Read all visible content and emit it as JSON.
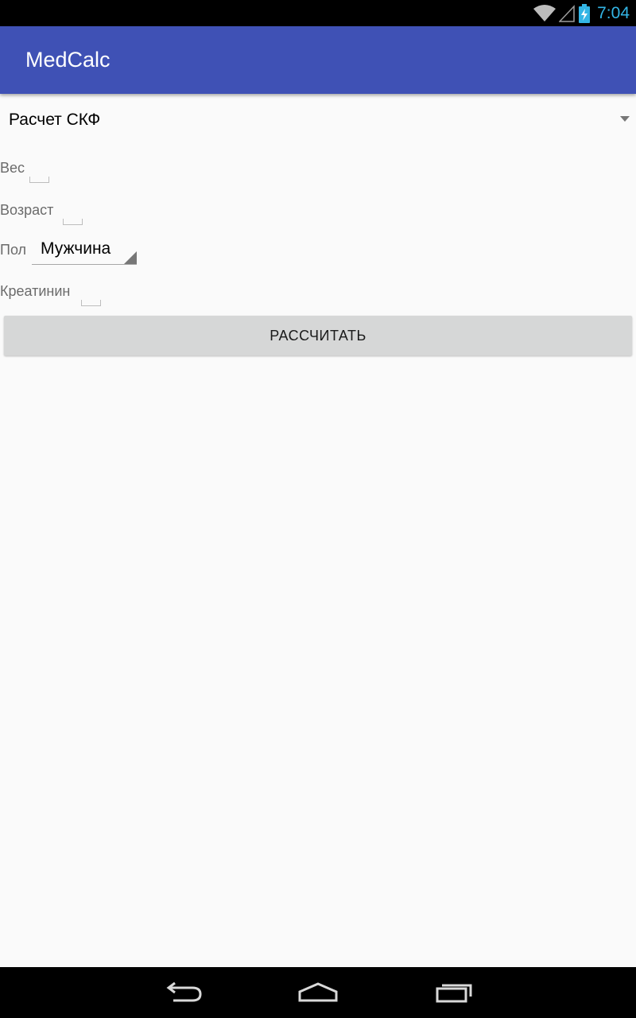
{
  "status_bar": {
    "time": "7:04",
    "icons": [
      "wifi-icon",
      "signal-icon",
      "battery-charging-icon"
    ],
    "time_color": "#33b5e5"
  },
  "app_bar": {
    "title": "MedCalc",
    "color": "#3f51b5"
  },
  "calculator_spinner": {
    "selected": "Расчет СКФ"
  },
  "form": {
    "weight_label": "Вес",
    "weight_value": "",
    "age_label": "Возраст",
    "age_value": "",
    "sex_label": "Пол",
    "sex_selected": "Мужчина",
    "creatinine_label": "Креатинин",
    "creatinine_value": ""
  },
  "calculate_button": {
    "label": "РАССЧИТАТЬ"
  },
  "nav_bar": {
    "icons": [
      "back-icon",
      "home-icon",
      "recents-icon"
    ]
  }
}
